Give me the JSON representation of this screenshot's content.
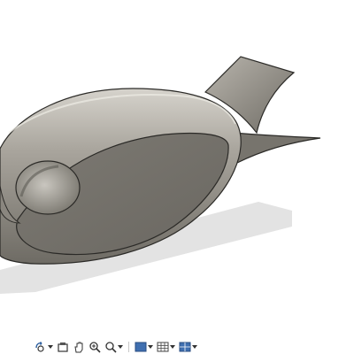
{
  "viewport": {
    "model": "fish-shaped-body",
    "colors": {
      "background": "#ffffff",
      "body_face": "#716e67",
      "body_rim": "#8f8b84",
      "edge": "#2b2a27",
      "shadow": "#e3e3e3"
    }
  },
  "navigation_toolbar": {
    "tools": [
      {
        "icon": "orbit-icon",
        "has_menu": true
      },
      {
        "icon": "look-at-icon",
        "has_menu": false
      },
      {
        "icon": "pan-icon",
        "has_menu": false
      },
      {
        "icon": "zoom-icon",
        "has_menu": false
      },
      {
        "icon": "fit-zoom-icon",
        "has_menu": true
      },
      {
        "icon": "display-settings-icon",
        "has_menu": true
      },
      {
        "icon": "grid-settings-icon",
        "has_menu": true
      },
      {
        "icon": "viewports-icon",
        "has_menu": true
      }
    ]
  }
}
